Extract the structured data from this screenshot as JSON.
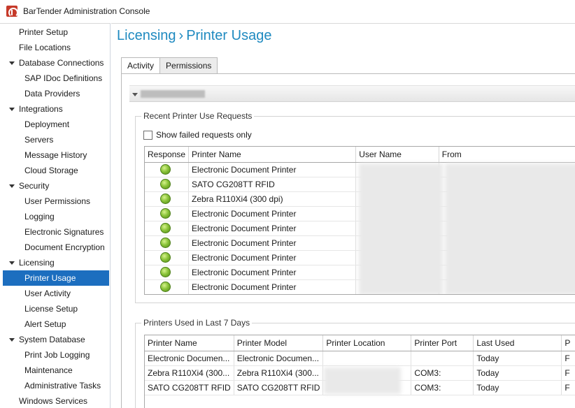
{
  "window": {
    "title": "BarTender Administration Console"
  },
  "sidebar": {
    "items": [
      {
        "label": "Printer Setup",
        "level": 0,
        "expandable": false,
        "selected": false
      },
      {
        "label": "File Locations",
        "level": 0,
        "expandable": false,
        "selected": false
      },
      {
        "label": "Database Connections",
        "level": 0,
        "expandable": true,
        "selected": false
      },
      {
        "label": "SAP IDoc Definitions",
        "level": 1,
        "expandable": false,
        "selected": false
      },
      {
        "label": "Data Providers",
        "level": 1,
        "expandable": false,
        "selected": false
      },
      {
        "label": "Integrations",
        "level": 0,
        "expandable": true,
        "selected": false
      },
      {
        "label": "Deployment",
        "level": 1,
        "expandable": false,
        "selected": false
      },
      {
        "label": "Servers",
        "level": 1,
        "expandable": false,
        "selected": false
      },
      {
        "label": "Message History",
        "level": 1,
        "expandable": false,
        "selected": false
      },
      {
        "label": "Cloud Storage",
        "level": 1,
        "expandable": false,
        "selected": false
      },
      {
        "label": "Security",
        "level": 0,
        "expandable": true,
        "selected": false
      },
      {
        "label": "User Permissions",
        "level": 1,
        "expandable": false,
        "selected": false
      },
      {
        "label": "Logging",
        "level": 1,
        "expandable": false,
        "selected": false
      },
      {
        "label": "Electronic Signatures",
        "level": 1,
        "expandable": false,
        "selected": false
      },
      {
        "label": "Document Encryption",
        "level": 1,
        "expandable": false,
        "selected": false
      },
      {
        "label": "Licensing",
        "level": 0,
        "expandable": true,
        "selected": false
      },
      {
        "label": "Printer Usage",
        "level": 1,
        "expandable": false,
        "selected": true
      },
      {
        "label": "User Activity",
        "level": 1,
        "expandable": false,
        "selected": false
      },
      {
        "label": "License Setup",
        "level": 1,
        "expandable": false,
        "selected": false
      },
      {
        "label": "Alert Setup",
        "level": 1,
        "expandable": false,
        "selected": false
      },
      {
        "label": "System Database",
        "level": 0,
        "expandable": true,
        "selected": false
      },
      {
        "label": "Print Job Logging",
        "level": 1,
        "expandable": false,
        "selected": false
      },
      {
        "label": "Maintenance",
        "level": 1,
        "expandable": false,
        "selected": false
      },
      {
        "label": "Administrative Tasks",
        "level": 1,
        "expandable": false,
        "selected": false
      },
      {
        "label": "Windows Services",
        "level": 0,
        "expandable": false,
        "selected": false
      }
    ]
  },
  "header": {
    "breadcrumb_parent": "Licensing",
    "breadcrumb_separator": "›",
    "breadcrumb_current": "Printer Usage"
  },
  "tabs": [
    {
      "label": "Activity",
      "active": true
    },
    {
      "label": "Permissions",
      "active": false
    }
  ],
  "recent_requests": {
    "title": "Recent Printer Use Requests",
    "show_failed_label": "Show failed requests only",
    "show_failed_checked": false,
    "columns": [
      "Response",
      "Printer Name",
      "User Name",
      "From"
    ],
    "rows": [
      {
        "status": "success",
        "printer": "Electronic Document Printer",
        "user": "",
        "from": ""
      },
      {
        "status": "success",
        "printer": "SATO CG208TT RFID",
        "user": "",
        "from": ""
      },
      {
        "status": "success",
        "printer": "Zebra R110Xi4 (300 dpi)",
        "user": "",
        "from": ""
      },
      {
        "status": "success",
        "printer": "Electronic Document Printer",
        "user": "",
        "from": ""
      },
      {
        "status": "success",
        "printer": "Electronic Document Printer",
        "user": "",
        "from": ""
      },
      {
        "status": "success",
        "printer": "Electronic Document Printer",
        "user": "",
        "from": ""
      },
      {
        "status": "success",
        "printer": "Electronic Document Printer",
        "user": "",
        "from": ""
      },
      {
        "status": "success",
        "printer": "Electronic Document Printer",
        "user": "",
        "from": ""
      },
      {
        "status": "success",
        "printer": "Electronic Document Printer",
        "user": "",
        "from": ""
      }
    ]
  },
  "printers_used": {
    "title": "Printers Used in Last 7 Days",
    "columns": [
      "Printer Name",
      "Printer Model",
      "Printer Location",
      "Printer Port",
      "Last Used",
      "P"
    ],
    "rows": [
      {
        "name": "Electronic Documen...",
        "model": "Electronic Documen...",
        "location": "",
        "port": "",
        "last_used": "Today",
        "extra": "F"
      },
      {
        "name": "Zebra R110Xi4 (300...",
        "model": "Zebra R110Xi4 (300...",
        "location": "",
        "port": "COM3:",
        "last_used": "Today",
        "extra": "F"
      },
      {
        "name": "SATO CG208TT RFID",
        "model": "SATO CG208TT RFID",
        "location": "",
        "port": "COM3:",
        "last_used": "Today",
        "extra": "F"
      }
    ]
  },
  "colors": {
    "accent": "#1f8ac0",
    "selection": "#1c6ebf",
    "status_success": "#8bc43a"
  }
}
